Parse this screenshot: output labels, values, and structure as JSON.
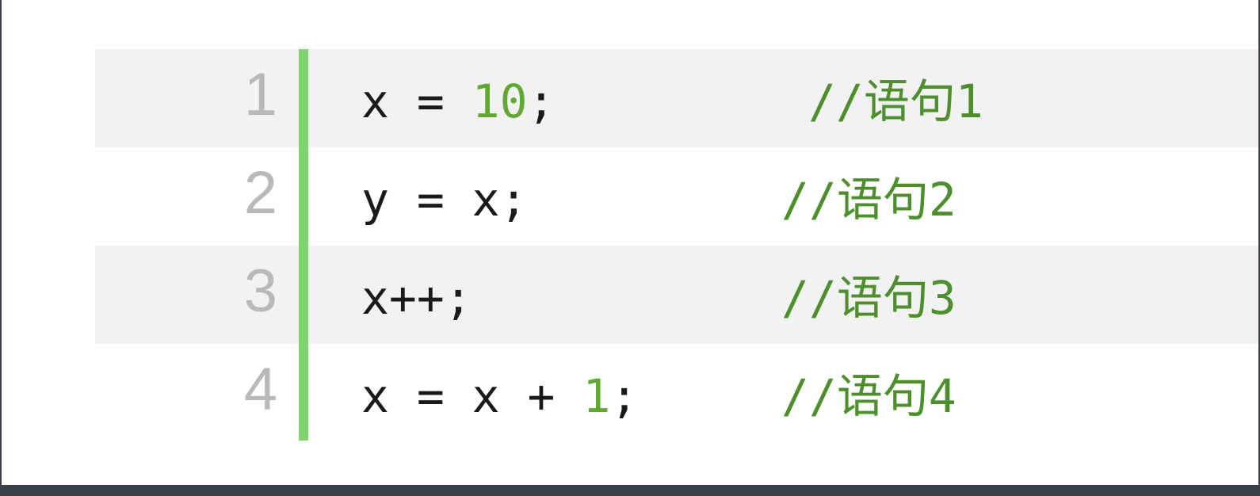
{
  "code_lines": [
    {
      "number": "1",
      "tokens": [
        "x = ",
        "10",
        ";"
      ],
      "comment": "//语句1"
    },
    {
      "number": "2",
      "text": "y = x;",
      "comment": "//语句2"
    },
    {
      "number": "3",
      "text": "x++;",
      "comment": "//语句3"
    },
    {
      "number": "4",
      "tokens": [
        "x = x + ",
        "1",
        ";"
      ],
      "comment": "//语句4"
    }
  ],
  "colors": {
    "gutter_bar": "#7fd46e",
    "line_number": "#b9b9b9",
    "number_literal": "#5fa832",
    "comment": "#4c8f2c",
    "shaded_row": "#f2f2f2"
  }
}
